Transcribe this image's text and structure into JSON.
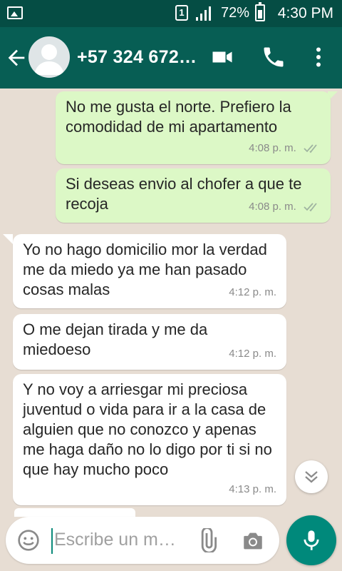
{
  "status_bar": {
    "sim": "1",
    "battery": "72%",
    "time": "4:30 PM"
  },
  "header": {
    "contact": "+57 324 672…"
  },
  "messages": [
    {
      "dir": "out",
      "text": "No me gusta el norte. Prefiero la comodidad de mi apartamento",
      "time": "4:08 p. m."
    },
    {
      "dir": "out",
      "text": "Si deseas envio al chofer a que te recoja",
      "time": "4:08 p. m."
    },
    {
      "dir": "in",
      "text": "Yo no hago domicilio mor la verdad me da miedo ya me han pasado cosas malas",
      "time": "4:12 p. m."
    },
    {
      "dir": "in",
      "text": "O me dejan tirada y me da miedoeso",
      "time": "4:12 p. m."
    },
    {
      "dir": "in",
      "text": "Y no voy a arriesgar mi preciosa juventud o vida para ir a la casa de alguien que no conozco y apenas me haga daño no lo digo por ti si no que hay mucho poco",
      "time": "4:13 p. m."
    }
  ],
  "composer": {
    "placeholder": "Escribe un m…"
  },
  "colors": {
    "header": "#075e54",
    "status_bar": "#054d44",
    "outgoing": "#dcf8c6",
    "incoming": "#ffffff",
    "accent": "#00897b",
    "read_ticks": "#9fb3a0"
  }
}
